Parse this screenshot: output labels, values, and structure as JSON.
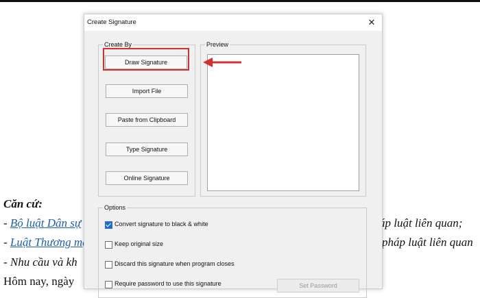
{
  "document": {
    "heading": "Căn cứ:",
    "lines": [
      {
        "prefix": "- ",
        "link": "Bộ luật Dân sự",
        "tail": "áp luật liên quan;"
      },
      {
        "prefix": "- ",
        "link": "Luật Thương mại",
        "tail": "pháp luật liên quan"
      },
      {
        "prefix": "- ",
        "text": "Nhu cầu và kh"
      }
    ],
    "last_line": "Hôm nay, ngày"
  },
  "dialog": {
    "title": "Create Signature",
    "close_glyph": "✕",
    "create_by": {
      "label": "Create By",
      "buttons": [
        "Draw Signature",
        "Import File",
        "Paste from Clipboard",
        "Type Signature",
        "Online Signature"
      ]
    },
    "preview": {
      "label": "Preview"
    },
    "options": {
      "label": "Options",
      "items": [
        {
          "label": "Convert signature to black & white",
          "checked": true
        },
        {
          "label": "Keep original size",
          "checked": false
        },
        {
          "label": "Discard this signature when program closes",
          "checked": false
        },
        {
          "label": "Require password to use this signature",
          "checked": false
        }
      ],
      "set_password": "Set Password"
    }
  },
  "annotation": {
    "color": "#d32f2f"
  }
}
